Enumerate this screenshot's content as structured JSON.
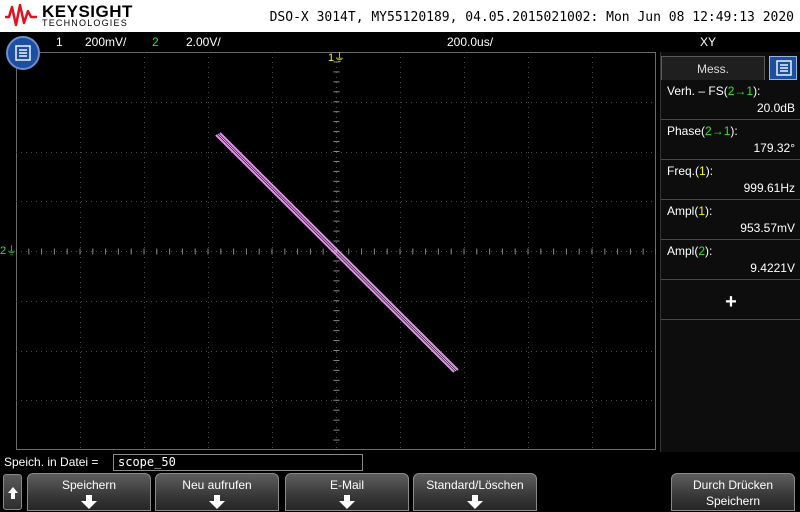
{
  "brand": {
    "name": "KEYSIGHT",
    "subtitle": "TECHNOLOGIES"
  },
  "device_info": "DSO-X 3014T, MY55120189, 04.05.2015021002: Mon Jun 08 12:49:13 2020",
  "status": {
    "ch1_num": "1",
    "ch1_scale": "200mV/",
    "ch2_num": "2",
    "ch2_scale": "2.00V/",
    "timebase": "200.0us/",
    "mode": "XY"
  },
  "markers": {
    "trigger": "1",
    "ch2": "2"
  },
  "panel": {
    "tab_label": "Mess.",
    "measurements": [
      {
        "pre": "Verh. – FS(",
        "src": "2→1",
        "post": "):",
        "value": "20.0dB"
      },
      {
        "pre": "Phase(",
        "src": "2→1",
        "post": "):",
        "value": "179.32°"
      },
      {
        "pre": "Freq.(",
        "src": "1",
        "post": "):",
        "value": "999.61Hz"
      },
      {
        "pre": "Ampl(",
        "src": "1",
        "post": "):",
        "value": "953.57mV"
      },
      {
        "pre": "Ampl(",
        "src": "2",
        "post": "):",
        "value": "9.4221V"
      }
    ],
    "add_label": "+"
  },
  "save": {
    "label": "Speich. in Datei =",
    "filename": "scope_50"
  },
  "softkeys": {
    "save": "Speichern",
    "refresh": "Neu aufrufen",
    "email": "E-Mail",
    "default_clear": "Standard/Löschen",
    "print_line1": "Durch Drücken",
    "print_line2": "Speichern"
  },
  "colors": {
    "ch1": "#f5f51e",
    "ch2": "#2ee52e",
    "trace": "#e890f0",
    "accent": "#1c4f9f",
    "brand_red": "#e3101e"
  },
  "icons": {
    "menu": "list-icon",
    "panel": "list-icon",
    "up": "up-arrow-icon",
    "softkey": "down-arrow-icon"
  }
}
